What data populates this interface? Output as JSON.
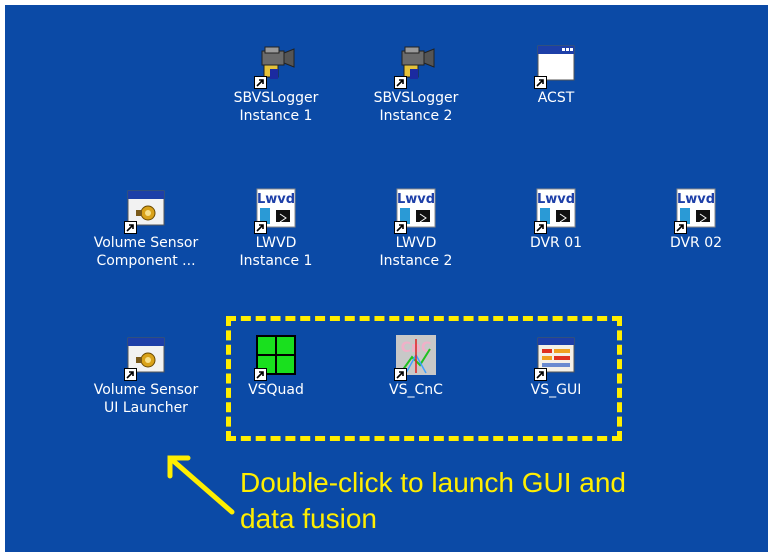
{
  "desktop": {
    "icons": [
      {
        "label": "SBVSLogger\nInstance 1",
        "icon": "camcorder-icon"
      },
      {
        "label": "SBVSLogger\nInstance 2",
        "icon": "camcorder-icon"
      },
      {
        "label": "ACST",
        "icon": "window-icon"
      },
      {
        "label": "Volume Sensor\nComponent ...",
        "icon": "app-gear-icon"
      },
      {
        "label": "LWVD\nInstance 1",
        "icon": "lwvd-icon"
      },
      {
        "label": "LWVD\nInstance 2",
        "icon": "lwvd-icon"
      },
      {
        "label": "DVR 01",
        "icon": "lwvd-icon"
      },
      {
        "label": "DVR 02",
        "icon": "lwvd-icon"
      },
      {
        "label": "Volume Sensor\nUI Launcher",
        "icon": "app-gear-icon"
      },
      {
        "label": "VSQuad",
        "icon": "green-grid-icon"
      },
      {
        "label": "VS_CnC",
        "icon": "cnc-icon"
      },
      {
        "label": "VS_GUI",
        "icon": "gui-window-icon"
      }
    ]
  },
  "annotation": {
    "text": "Double-click to launch GUI and\ndata fusion",
    "color": "#ffee00"
  },
  "colors": {
    "desktop_background": "#0b4aa6",
    "label_text": "#ffffff"
  }
}
